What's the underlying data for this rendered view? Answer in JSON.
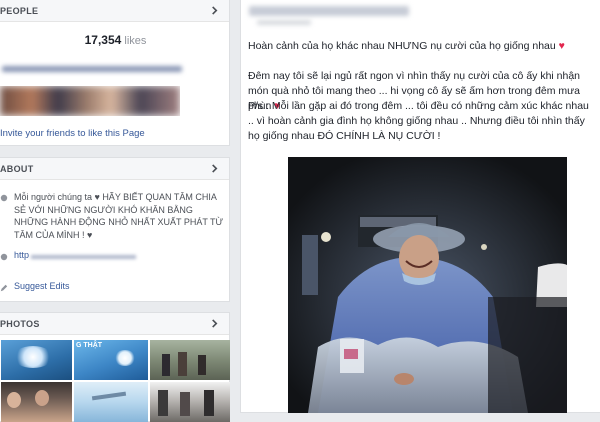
{
  "people": {
    "header": "PEOPLE",
    "likes_count": "17,354",
    "likes_label": "likes",
    "invite_text": "Invite your friends to like this Page"
  },
  "about": {
    "header": "ABOUT",
    "description": "Mỗi người chúng ta ♥ HÃY BIẾT QUAN TÂM CHIA SẺ VỚI NHỮNG NGƯỜI KHÓ KHĂN BẰNG NHỮNG HÀNH ĐỘNG NHỎ NHẤT XUẤT PHÁT TỪ TÂM CỦA MÌNH ! ♥",
    "website_prefix": "http",
    "suggest_edits": "Suggest Edits"
  },
  "photos": {
    "header": "PHOTOS",
    "thumb_caption": "G THẬT"
  },
  "post": {
    "line1": "Hoàn cảnh của họ khác nhau NHƯNG nụ cười của họ giống nhau",
    "para2": "Đêm nay tôi sẽ lại ngủ rất ngon vì nhìn thấy nụ cười của cô ấy khi nhận món quà nhỏ tôi mang theo ... hi vọng cô ấy sẽ ấm hơn trong đêm mưa phùn",
    "para3": "P/s : Mỗi lần gặp ai đó trong đêm ... tôi đều có những cảm xúc khác nhau .. vì hoàn cảnh gia đình họ không giống nhau .. Nhưng điều tôi nhìn thấy họ giống nhau ĐÓ CHÍNH LÀ NỤ CƯỜI !"
  },
  "colors": {
    "link": "#365899",
    "heart": "#e2264d",
    "background": "#e9ebee"
  }
}
